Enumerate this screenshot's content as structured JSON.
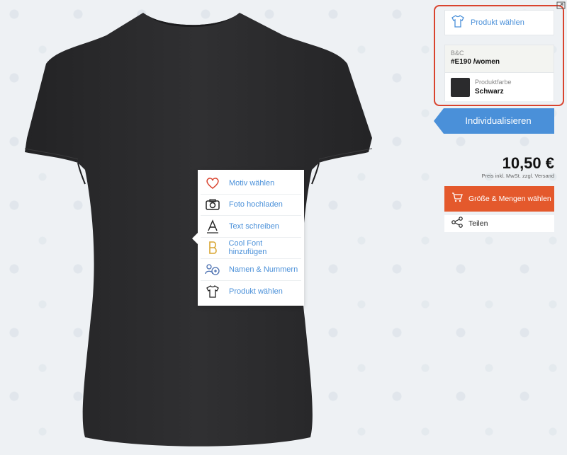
{
  "context_menu": {
    "items": [
      {
        "label": "Motiv wählen",
        "icon": "heart-icon"
      },
      {
        "label": "Foto hochladen",
        "icon": "camera-icon"
      },
      {
        "label": "Text schreiben",
        "icon": "text-icon"
      },
      {
        "label": "Cool Font hinzufügen",
        "icon": "cool-font-icon"
      },
      {
        "label": "Namen & Nummern",
        "icon": "names-numbers-icon"
      },
      {
        "label": "Produkt wählen",
        "icon": "tshirt-icon"
      }
    ]
  },
  "product_panel": {
    "choose_product_label": "Produkt wählen",
    "brand": "B&C",
    "model": "#E190 /women",
    "color_label": "Produktfarbe",
    "color_value": "Schwarz",
    "color_hex": "#2b2b2d"
  },
  "customize_button": "Individualisieren",
  "price": "10,50 €",
  "price_note": "Preis inkl. MwSt. zzgl. Versand",
  "size_button": "Größe & Mengen wählen",
  "share_button": "Teilen",
  "colors": {
    "accent_blue": "#4a90d9",
    "orange": "#e4592c",
    "highlight_red": "#d9432e",
    "shirt": "#2a2a2c"
  }
}
